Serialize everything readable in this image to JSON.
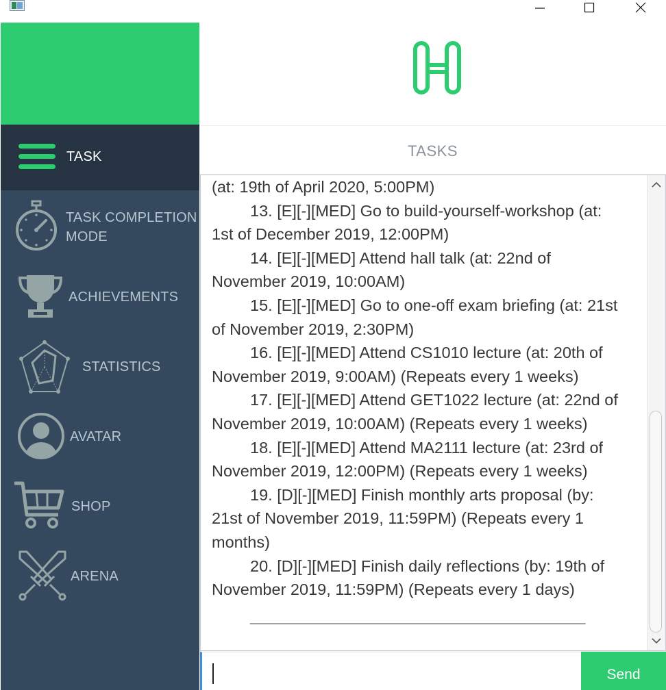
{
  "window": {
    "icon": "app-window-icon",
    "controls": [
      "minimize-icon",
      "maximize-icon",
      "close-icon"
    ]
  },
  "brand": {
    "logo": "h-letter-logo-icon",
    "accent_color": "#2ecc71"
  },
  "sidebar": {
    "active": "TASK",
    "items": [
      {
        "label": "TASK",
        "icon": "hamburger-menu-icon"
      },
      {
        "label": "TASK COMPLETION MODE",
        "line1": "TASK COMPLETION",
        "line2": "MODE",
        "icon": "stopwatch-icon"
      },
      {
        "label": "ACHIEVEMENTS",
        "icon": "trophy-icon"
      },
      {
        "label": "STATISTICS",
        "icon": "radar-chart-icon"
      },
      {
        "label": "AVATAR",
        "icon": "user-avatar-icon"
      },
      {
        "label": "SHOP",
        "icon": "shopping-cart-icon"
      },
      {
        "label": "ARENA",
        "icon": "crossed-swords-icon"
      }
    ]
  },
  "main": {
    "title": "TASKS",
    "task_lines": [
      {
        "first": "",
        "cont": "(at: 19th of April 2020, 5:00PM)"
      },
      {
        "first": "13. [E][-][MED] Go to build-yourself-workshop (at:",
        "cont": "1st of December 2019, 12:00PM)"
      },
      {
        "first": "14. [E][-][MED] Attend hall talk (at: 22nd of",
        "cont": "November 2019, 10:00AM)"
      },
      {
        "first": "15. [E][-][MED] Go to one-off exam briefing (at: 21st",
        "cont": "of November 2019, 2:30PM)"
      },
      {
        "first": "16. [E][-][MED] Attend CS1010 lecture (at: 20th of",
        "cont": "November 2019, 9:00AM) (Repeats every 1 weeks)"
      },
      {
        "first": "17. [E][-][MED] Attend GET1022 lecture (at: 22nd of",
        "cont": "November 2019, 10:00AM) (Repeats every 1 weeks)"
      },
      {
        "first": "18. [E][-][MED] Attend MA2111 lecture (at: 23rd of",
        "cont": "November 2019, 12:00PM) (Repeats every 1 weeks)"
      },
      {
        "first": "19. [D][-][MED] Finish monthly arts proposal (by:",
        "cont": "21st of November 2019, 11:59PM) (Repeats every 1",
        "cont2": "months)"
      },
      {
        "first": "20. [D][-][MED] Finish daily reflections (by: 19th of",
        "cont": "November 2019, 11:59PM) (Repeats every 1 days)"
      }
    ],
    "separator": "____________________________________________"
  },
  "input": {
    "value": "",
    "placeholder": ""
  },
  "send_button": {
    "label": "Send"
  }
}
